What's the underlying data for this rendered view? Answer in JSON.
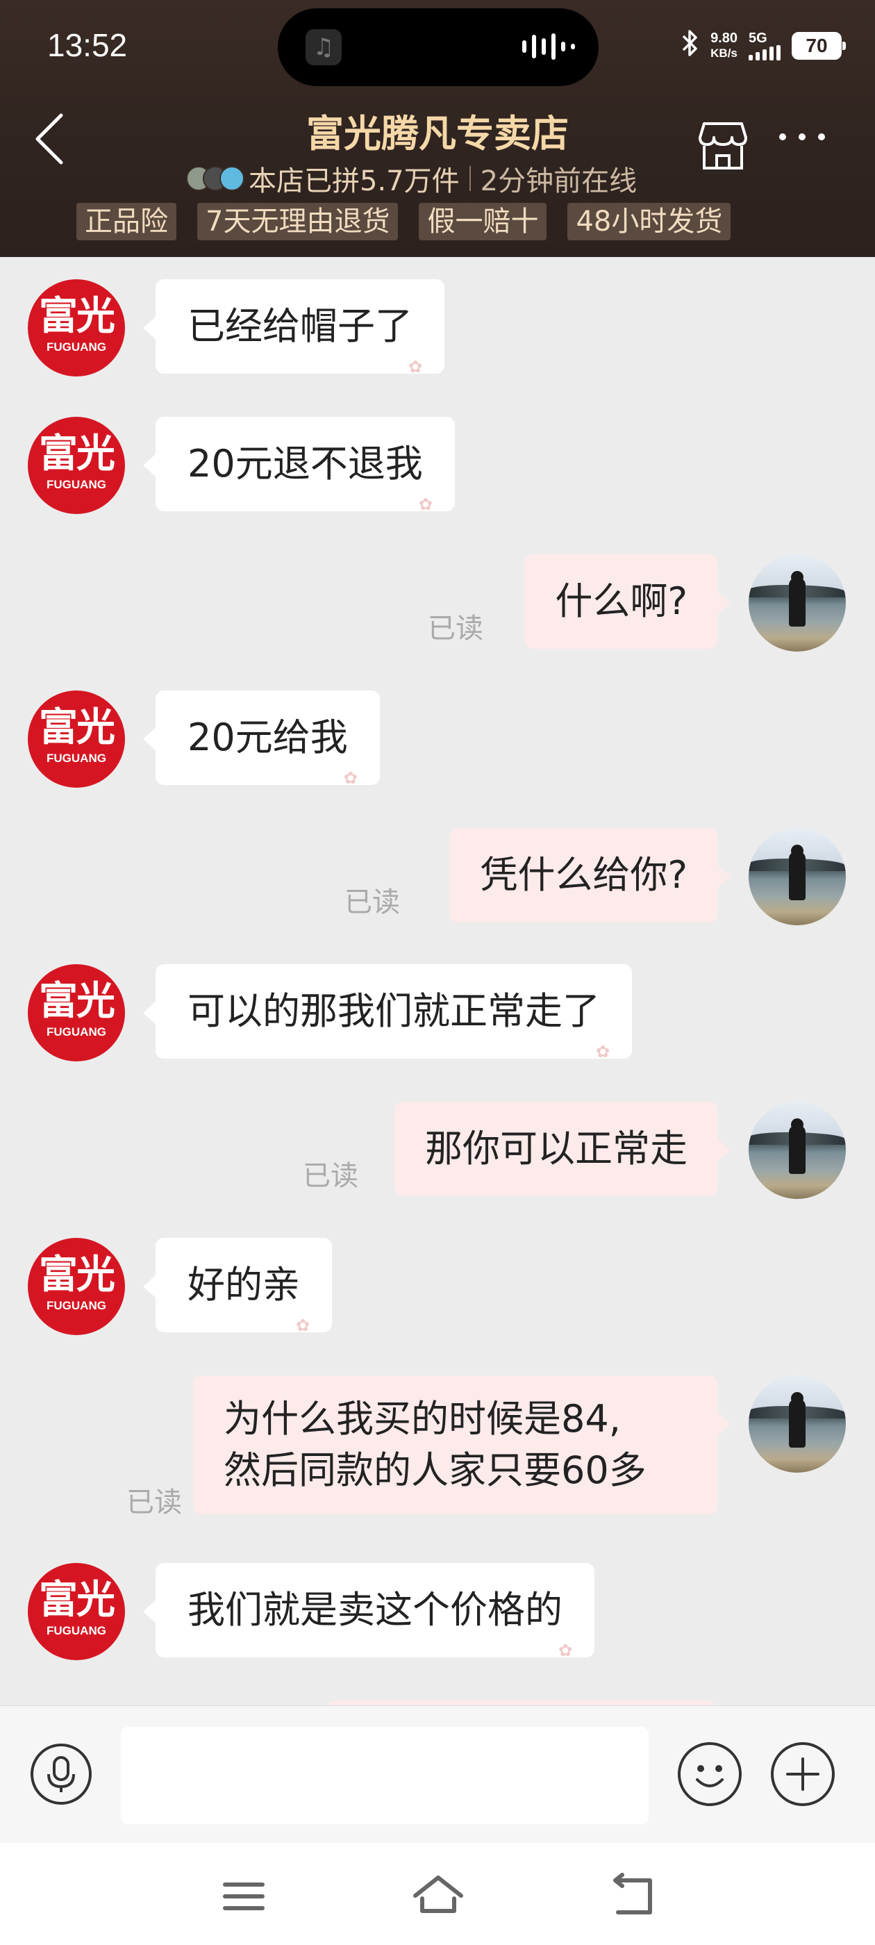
{
  "status_bar": {
    "time": "13:52",
    "net_speed_value": "9.80",
    "net_speed_unit": "KB/s",
    "network": "5G",
    "battery": "70",
    "music_icon": "music-note-icon",
    "bluetooth_icon": "bluetooth-icon"
  },
  "header": {
    "shop_name": "富光腾凡专卖店",
    "sales_info": "本店已拼5.7万件",
    "online_status": "2分钟前在线",
    "badges": [
      "正品险",
      "7天无理由退货",
      "假一赔十",
      "48小时发货"
    ],
    "back_icon": "chevron-left-icon",
    "store_icon": "storefront-icon",
    "more_icon": "more-dots-icon",
    "brand_color": "#3a2b24",
    "title_color": "#f6d8a8"
  },
  "shop_avatar": {
    "cn": "富光",
    "en": "FUGUANG",
    "color": "#d51622"
  },
  "messages": [
    {
      "side": "left",
      "text": "已经给帽子了"
    },
    {
      "side": "left",
      "text": "20元退不退我"
    },
    {
      "side": "right",
      "text": "什么啊?",
      "status": "已读"
    },
    {
      "side": "left",
      "text": "20元给我"
    },
    {
      "side": "right",
      "text": "凭什么给你?",
      "status": "已读"
    },
    {
      "side": "left",
      "text": "可以的那我们就正常走了"
    },
    {
      "side": "right",
      "text": "那你可以正常走",
      "status": "已读"
    },
    {
      "side": "left",
      "text": "好的亲"
    },
    {
      "side": "right",
      "lines": [
        "为什么我买的时候是84,",
        "然后同款的人家只要60多"
      ],
      "status": "已读"
    },
    {
      "side": "left",
      "text": "我们就是卖这个价格的"
    }
  ],
  "input_bar": {
    "placeholder": "",
    "voice_icon": "microphone-icon",
    "emoji_icon": "smiley-icon",
    "plus_icon": "plus-icon"
  },
  "nav_bar": {
    "menu_icon": "menu-icon",
    "home_icon": "home-icon",
    "back_icon": "back-arrow-icon"
  }
}
